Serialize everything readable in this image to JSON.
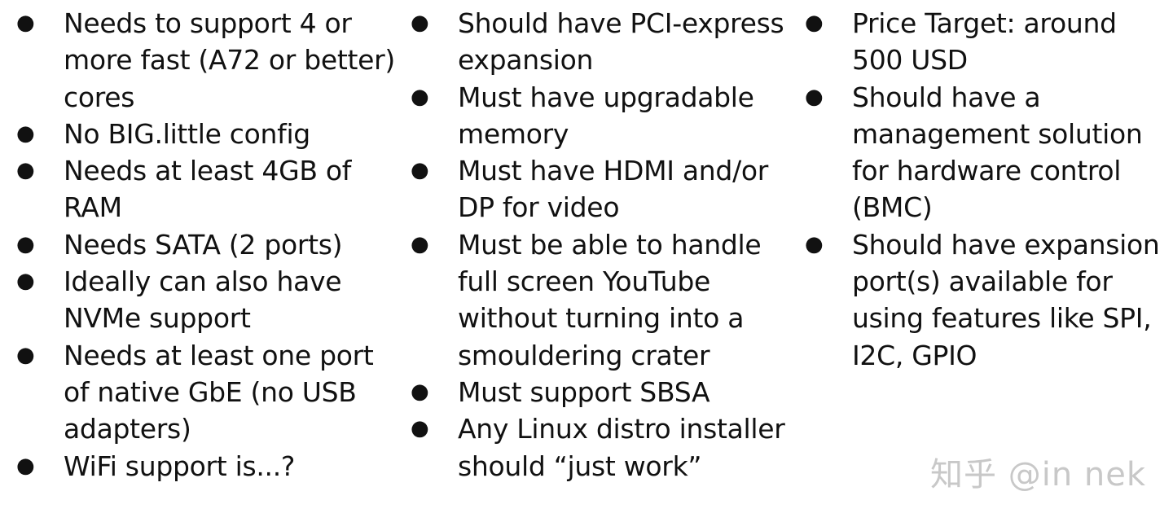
{
  "columns": [
    {
      "items": [
        "Needs to support 4 or more fast (A72 or better) cores",
        "No BIG.little config",
        "Needs at least 4GB of RAM",
        "Needs SATA (2 ports)",
        "Ideally can also have NVMe support",
        "Needs at least one port of native GbE (no USB adapters)",
        "WiFi support is...?"
      ]
    },
    {
      "items": [
        "Should have PCI-express expansion",
        "Must have upgradable memory",
        "Must have HDMI and/or DP for video",
        "Must be able to handle full screen YouTube without turning into a smouldering crater",
        "Must support SBSA",
        "Any Linux distro installer should “just work”"
      ]
    },
    {
      "items": [
        "Price Target: around 500 USD",
        "Should have a management solution for hardware control (BMC)",
        "Should have expansion port(s) available for using features like SPI, I2C, GPIO"
      ]
    }
  ],
  "bullet_glyph": "●",
  "watermark": "知乎 @in nek"
}
